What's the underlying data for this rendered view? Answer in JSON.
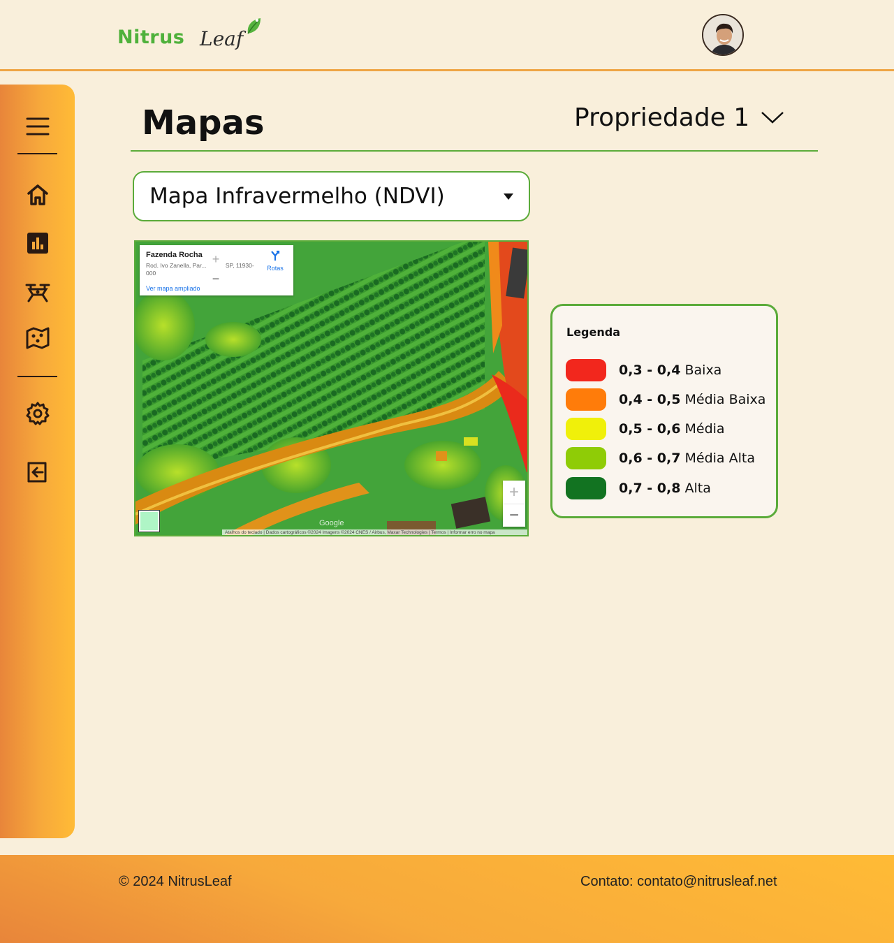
{
  "brand": {
    "name_part1": "Nitrus",
    "name_part2": "Leaf",
    "accent": "#5bab3a",
    "orange": "#f7a93b"
  },
  "header": {
    "avatar": "user-avatar"
  },
  "sidebar": {
    "items": [
      {
        "icon": "menu-icon"
      },
      {
        "icon": "home-icon"
      },
      {
        "icon": "bar-chart-icon"
      },
      {
        "icon": "drone-icon"
      },
      {
        "icon": "map-icon"
      },
      {
        "icon": "gear-icon"
      },
      {
        "icon": "logout-icon"
      }
    ]
  },
  "main": {
    "title": "Mapas",
    "property_select": "Propriedade 1",
    "map_select": "Mapa Infravermelho (NDVI)"
  },
  "map": {
    "place_name": "Fazenda Rocha",
    "address": "Rod. Ivo Zanella, Par... -Açu - SP, 11930-000",
    "larger_map_link": "Ver mapa ampliado",
    "routes_label": "Rotas",
    "zoom_in": "+",
    "zoom_out": "−",
    "google": "Google",
    "attribution": "Atalhos do teclado | Dados cartográficos ©2024 Imagens ©2024 CNES / Airbus, Maxar Technologies | Termos | Informar erro no mapa"
  },
  "legend": {
    "title": "Legenda",
    "items": [
      {
        "range": "0,3 - 0,4",
        "label": "Baixa",
        "color": "#f2271d"
      },
      {
        "range": "0,4 - 0,5",
        "label": "Média Baixa",
        "color": "#ff7c0a"
      },
      {
        "range": "0,5 - 0,6",
        "label": "Média",
        "color": "#f0f00a"
      },
      {
        "range": "0,6 - 0,7",
        "label": "Média Alta",
        "color": "#8fcc06"
      },
      {
        "range": "0,7 - 0,8",
        "label": "Alta",
        "color": "#127321"
      }
    ]
  },
  "footer": {
    "copyright": "© 2024 NitrusLeaf",
    "contact": "Contato: contato@nitrusleaf.net"
  }
}
